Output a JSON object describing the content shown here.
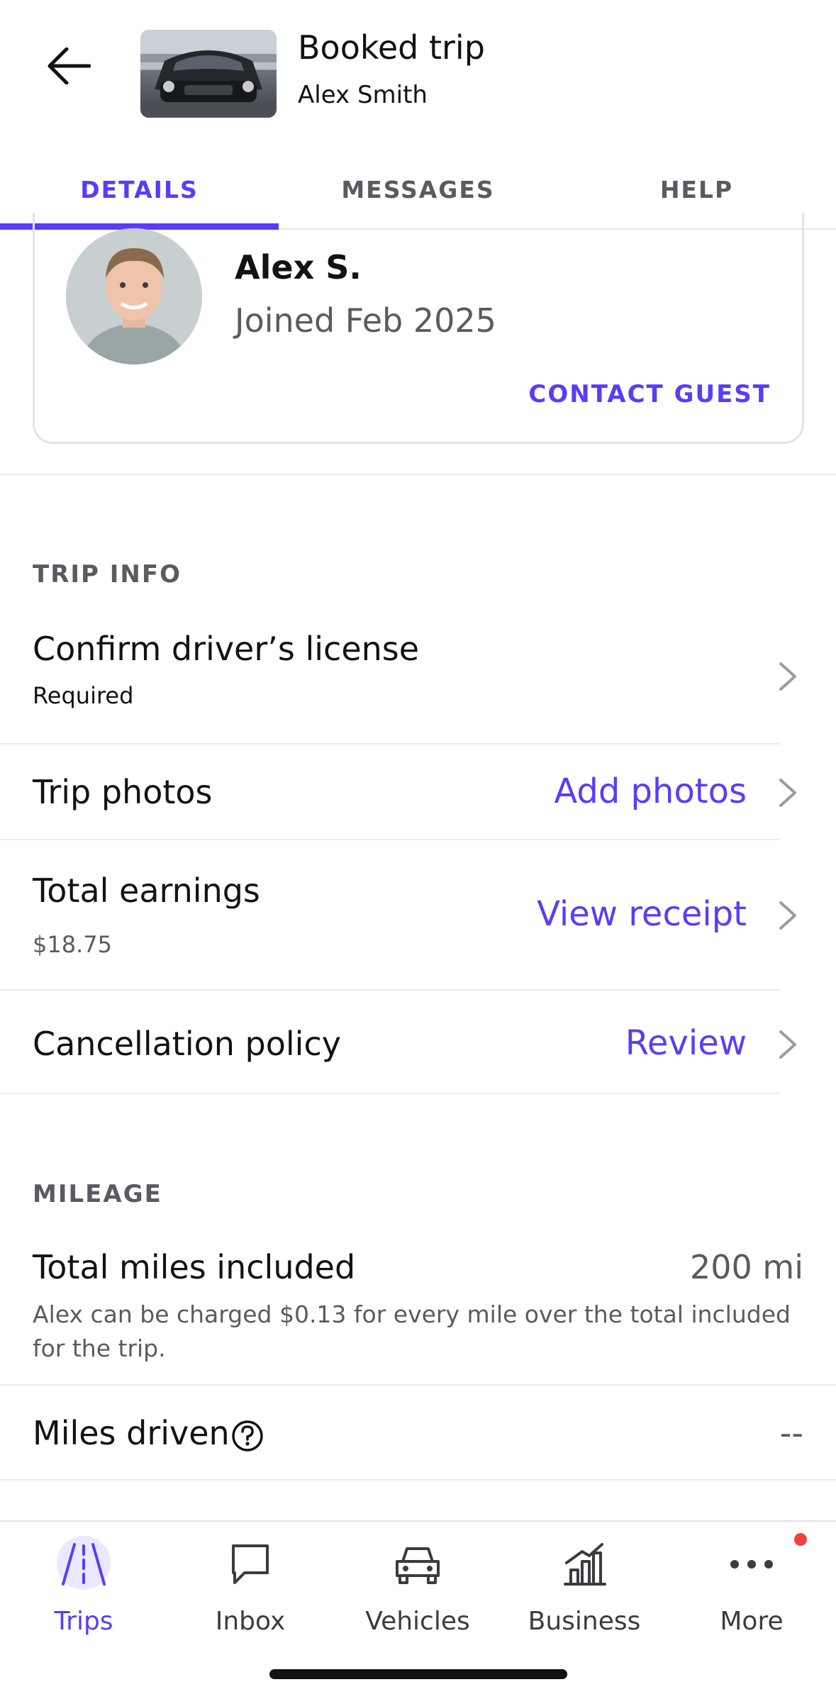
{
  "header": {
    "title": "Booked trip",
    "subtitle": "Alex Smith"
  },
  "tabs": [
    {
      "label": "DETAILS",
      "active": true
    },
    {
      "label": "MESSAGES",
      "active": false
    },
    {
      "label": "HELP",
      "active": false
    }
  ],
  "guest": {
    "name": "Alex S.",
    "joined": "Joined Feb 2025",
    "contact_label": "CONTACT GUEST"
  },
  "trip_info": {
    "section_title": "TRIP INFO",
    "license": {
      "title": "Confirm driver’s license",
      "sub": "Required"
    },
    "photos": {
      "title": "Trip photos",
      "action": "Add photos"
    },
    "earnings": {
      "title": "Total earnings",
      "sub": "$18.75",
      "action": "View receipt"
    },
    "cancellation": {
      "title": "Cancellation policy",
      "action": "Review"
    }
  },
  "mileage": {
    "section_title": "MILEAGE",
    "included": {
      "title": "Total miles included",
      "value": "200 mi",
      "desc": "Alex can be charged $0.13 for every mile over the total included for the trip."
    },
    "driven": {
      "title": "Miles driven",
      "value": "--"
    }
  },
  "nav": {
    "trips": "Trips",
    "inbox": "Inbox",
    "vehicles": "Vehicles",
    "business": "Business",
    "more": "More"
  },
  "colors": {
    "accent": "#593cfb",
    "text": "#121214",
    "muted": "#5a5a62",
    "badge": "#f2403c"
  }
}
